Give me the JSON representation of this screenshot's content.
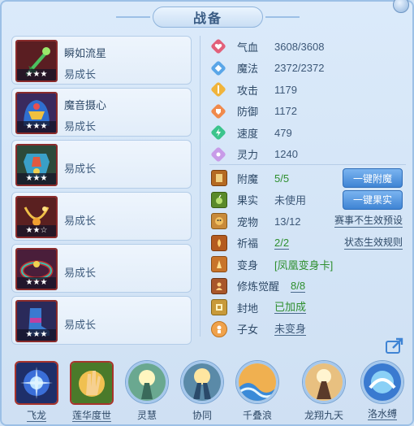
{
  "title": "战备",
  "equipment": [
    {
      "name": "瞬如流星",
      "growth": "易成长",
      "stars": "★★★"
    },
    {
      "name": "魔音摄心",
      "growth": "易成长",
      "stars": "★★★"
    },
    {
      "name": "",
      "growth": "易成长",
      "stars": "★★★"
    },
    {
      "name": "",
      "growth": "易成长",
      "stars": "★★☆"
    },
    {
      "name": "",
      "growth": "易成长",
      "stars": "★★★"
    },
    {
      "name": "",
      "growth": "易成长",
      "stars": "★★★"
    }
  ],
  "attributes": [
    {
      "label": "气血",
      "value": "3608/3608",
      "icon": "heart-icon",
      "color": "#e2607a"
    },
    {
      "label": "魔法",
      "value": "2372/2372",
      "icon": "diamond-icon",
      "color": "#5aa6e8"
    },
    {
      "label": "攻击",
      "value": "1179",
      "icon": "attack-icon",
      "color": "#f0b43c"
    },
    {
      "label": "防御",
      "value": "1172",
      "icon": "shield-icon",
      "color": "#f08a4c"
    },
    {
      "label": "速度",
      "value": "479",
      "icon": "bolt-icon",
      "color": "#3cc48c"
    },
    {
      "label": "灵力",
      "value": "1240",
      "icon": "spirit-icon",
      "color": "#c89be8"
    }
  ],
  "features": {
    "enchant": {
      "label": "附魔",
      "value": "5/5",
      "button": "一键附魔"
    },
    "fruit": {
      "label": "果实",
      "value": "未使用",
      "button": "一键果实"
    },
    "pet": {
      "label": "宠物",
      "value": "13/12",
      "link": "赛事不生效预设"
    },
    "bless": {
      "label": "祈福",
      "value": "2/2",
      "link": "状态生效规则"
    },
    "transform": {
      "label": "变身",
      "value": "[凤凰变身卡]"
    },
    "awaken": {
      "label": "修炼觉醒",
      "value": "8/8"
    },
    "seal": {
      "label": "封地",
      "value": "已加成"
    },
    "children": {
      "label": "子女",
      "value": "未变身"
    }
  },
  "skills": [
    {
      "name": "飞龙",
      "shape": "square"
    },
    {
      "name": "莲华度世",
      "shape": "square"
    },
    {
      "name": "灵慧",
      "shape": "circle"
    },
    {
      "name": "协同",
      "shape": "circle"
    },
    {
      "name": "千叠浪",
      "shape": "circle"
    },
    {
      "name": "龙翔九天",
      "shape": "circle"
    },
    {
      "name": "洛水缚",
      "shape": "circle"
    }
  ],
  "colors": {
    "accent": "#3f84d4",
    "green": "#2e8f2e",
    "frame": "#9cc0e6"
  }
}
